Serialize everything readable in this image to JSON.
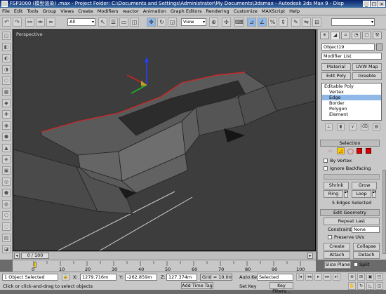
{
  "window": {
    "title": "FSP3000 (模型渲染) .max - Project Folder: C:\\Documents and Settings\\Administrator\\My Documents\\3dsmax - Autodesk 3ds Max 9 - Disp"
  },
  "menu": [
    "File",
    "Edit",
    "Tools",
    "Group",
    "Views",
    "Create",
    "Modifiers",
    "reactor",
    "Animation",
    "Graph Editors",
    "Rendering",
    "Customize",
    "MAXScript",
    "Help"
  ],
  "toolbar": {
    "selection_filter": "All",
    "reference_coord": "View",
    "named_selection": ""
  },
  "viewport": {
    "label": "Perspective"
  },
  "command_panel": {
    "object_name": "Object19",
    "modifier_list": "Modifier List",
    "buttons": {
      "material": "Material",
      "uvw_map": "UVW Map",
      "edit_poly": "Edit Poly",
      "greeble": "Greeble"
    },
    "stack": [
      "Editable Poly",
      "Vertex",
      "Edge",
      "Border",
      "Polygon",
      "Element"
    ],
    "selection_rollout": {
      "title": "Selection",
      "by_vertex": "By Vertex",
      "ignore_backfacing": "Ignore Backfacing",
      "shrink": "Shrink",
      "grow": "Grow",
      "ring": "Ring",
      "loop": "Loop",
      "status": "5 Edges Selected"
    },
    "edit_geometry_rollout": {
      "title": "Edit Geometry",
      "repeat_last": "Repeat Last",
      "constraints_label": "Constraints:",
      "constraints_value": "None",
      "preserve_uvs": "Preserve UVs",
      "create": "Create",
      "collapse": "Collapse",
      "attach": "Attach",
      "detach": "Detach",
      "slice_plane": "Slice Plane",
      "split": "Split"
    }
  },
  "time_slider": {
    "label": "0 / 100",
    "ticks": [
      "0",
      "10",
      "20",
      "30",
      "40",
      "50",
      "60",
      "70",
      "80",
      "90",
      "100"
    ]
  },
  "status": {
    "selected": "1 Object Selected",
    "prompt": "Click or click-and-drag to select objects",
    "x_label": "X:",
    "x_value": "1279.716m",
    "y_label": "Y:",
    "y_value": "-262.859m",
    "z_label": "Z:",
    "z_value": "127.374m",
    "grid": "Grid = 10.0mm",
    "add_time_tag": "Add Time Tag",
    "auto_key": "Auto Key",
    "auto_key_value": "Selected",
    "set_key": "Set Key",
    "key_filters": "Key Filters..."
  },
  "colors": {
    "selected_edge": "#d02828",
    "viewport_bg": "#3d3d3d",
    "gizmo_x": "#e02020",
    "gizmo_y": "#20c020",
    "gizmo_z": "#2040ff"
  }
}
